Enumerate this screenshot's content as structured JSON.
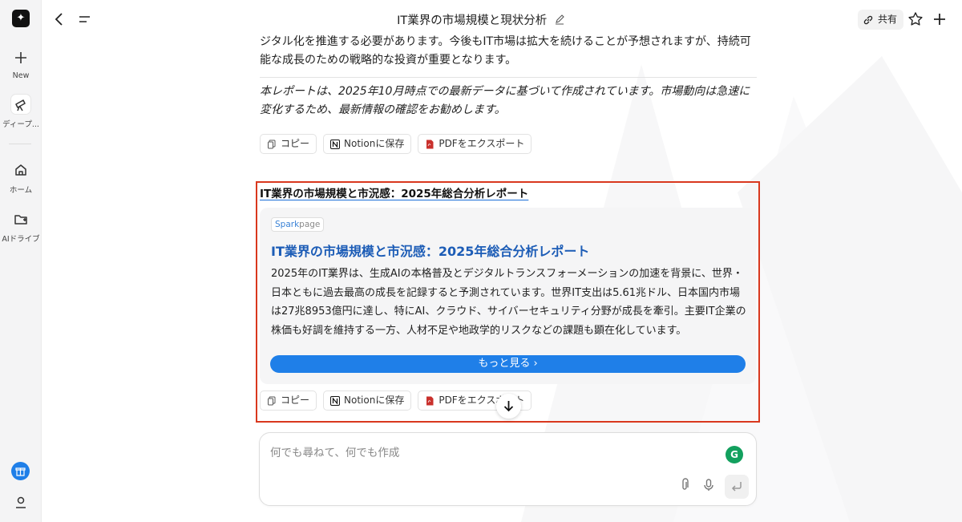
{
  "sidebar": {
    "new_label": "New",
    "deep_label": "ディープ...",
    "home_label": "ホーム",
    "drive_label": "AIドライブ",
    "icons": [
      "logo-icon",
      "plus-icon",
      "telescope-icon",
      "home-icon",
      "folder-icon",
      "gift-icon",
      "user-icon"
    ]
  },
  "header": {
    "title": "IT業界の市場規模と現状分析",
    "share_label": "共有"
  },
  "content": {
    "para1": "ジタル化を推進する必要があります。今後もIT市場は拡大を続けることが予想されますが、持続可能な成長のための戦略的な投資が重要となります。",
    "para2": "本レポートは、2025年10月時点での最新データに基づいて作成されています。市場動向は急速に変化するため、最新情報の確認をお勧めします。",
    "actions": {
      "copy": "コピー",
      "notion": "Notionに保存",
      "pdf": "PDFをエクスポート"
    },
    "link_title": "IT業界の市場規模と市況感：2025年総合分析レポート",
    "card": {
      "badge_a": "Spark",
      "badge_b": "page",
      "title": "IT業界の市場規模と市況感：2025年総合分析レポート",
      "body": "2025年のIT業界は、生成AIの本格普及とデジタルトランスフォーメーションの加速を背景に、世界・日本ともに過去最高の成長を記録すると予測されています。世界IT支出は5.61兆ドル、日本国内市場は27兆8953億円に達し、特にAI、クラウド、サイバーセキュリティ分野が成長を牽引。主要IT企業の株価も好調を維持する一方、人材不足や地政学的リスクなどの課題も顕在化しています。",
      "more_label": "もっと見る ›"
    }
  },
  "composer": {
    "placeholder": "何でも尋ねて、何でも作成"
  },
  "colors": {
    "accent": "#1f7fe8",
    "highlight_border": "#d9381e",
    "card_title": "#1c5cb6",
    "grammarly": "#13a05e"
  }
}
